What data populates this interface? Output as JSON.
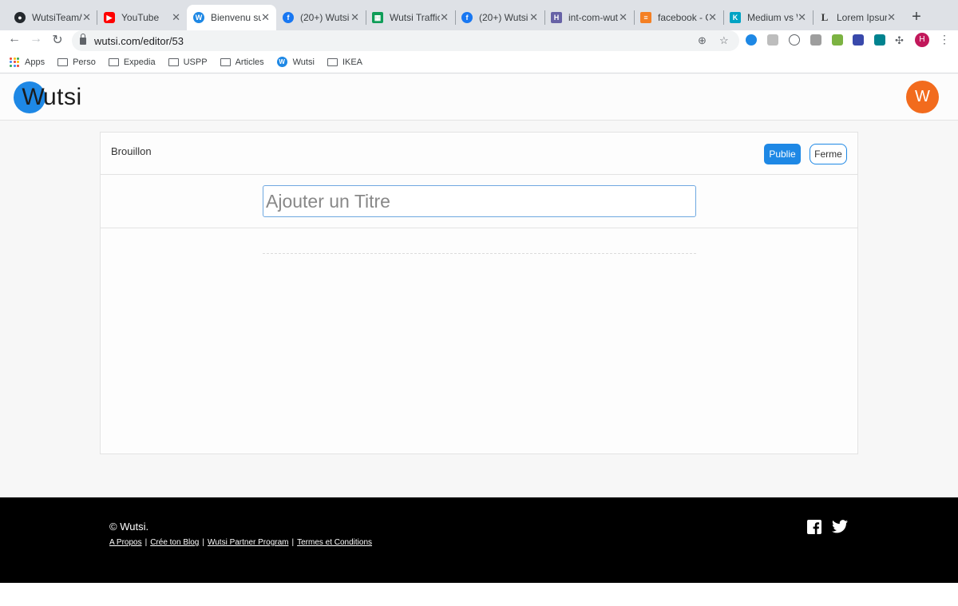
{
  "browser": {
    "tabs": [
      {
        "label": "WutsiTeam/w",
        "favicon": "github-icon",
        "color": "#24292e"
      },
      {
        "label": "YouTube",
        "favicon": "youtube-icon",
        "color": "#ff0000"
      },
      {
        "label": "Bienvenu su",
        "favicon": "wutsi-icon",
        "color": "#1e88e5",
        "active": true
      },
      {
        "label": "(20+) Wutsi",
        "favicon": "facebook-icon",
        "color": "#1877f2"
      },
      {
        "label": "Wutsi Traffic",
        "favicon": "sheets-icon",
        "color": "#0f9d58"
      },
      {
        "label": "(20+) Wutsi",
        "favicon": "facebook-icon",
        "color": "#1877f2"
      },
      {
        "label": "int-com-wut",
        "favicon": "heroku-icon",
        "color": "#6762a6"
      },
      {
        "label": "facebook - G",
        "favicon": "stack-icon",
        "color": "#f48024"
      },
      {
        "label": "Medium vs W",
        "favicon": "k-icon",
        "color": "#00a3c4"
      },
      {
        "label": "Lorem Ipsum",
        "favicon": "l-icon",
        "color": "#333333"
      }
    ],
    "url": "wutsi.com/editor/53",
    "profile_initial": "H",
    "bookmarks": [
      {
        "label": "Apps",
        "icon": "apps-grid-icon"
      },
      {
        "label": "Perso",
        "icon": "folder-icon"
      },
      {
        "label": "Expedia",
        "icon": "folder-icon"
      },
      {
        "label": "USPP",
        "icon": "folder-icon"
      },
      {
        "label": "Articles",
        "icon": "folder-icon"
      },
      {
        "label": "Wutsi",
        "icon": "wutsi-icon"
      },
      {
        "label": "IKEA",
        "icon": "folder-icon"
      }
    ]
  },
  "header": {
    "logo_w": "W",
    "logo_rest": "utsi",
    "user_initial": "W"
  },
  "editor": {
    "status": "Brouillon",
    "publish_label": "Publie",
    "close_label": "Ferme",
    "title_placeholder": "Ajouter un Titre",
    "title_value": ""
  },
  "footer": {
    "copyright": "© Wutsi.",
    "links": [
      "A Propos",
      "Crée ton Blog",
      "Wutsi Partner Program",
      "Termes et Conditions"
    ]
  },
  "colors": {
    "accent": "#1e88e5",
    "avatar": "#f26b1d",
    "footer_bg": "#000000"
  }
}
